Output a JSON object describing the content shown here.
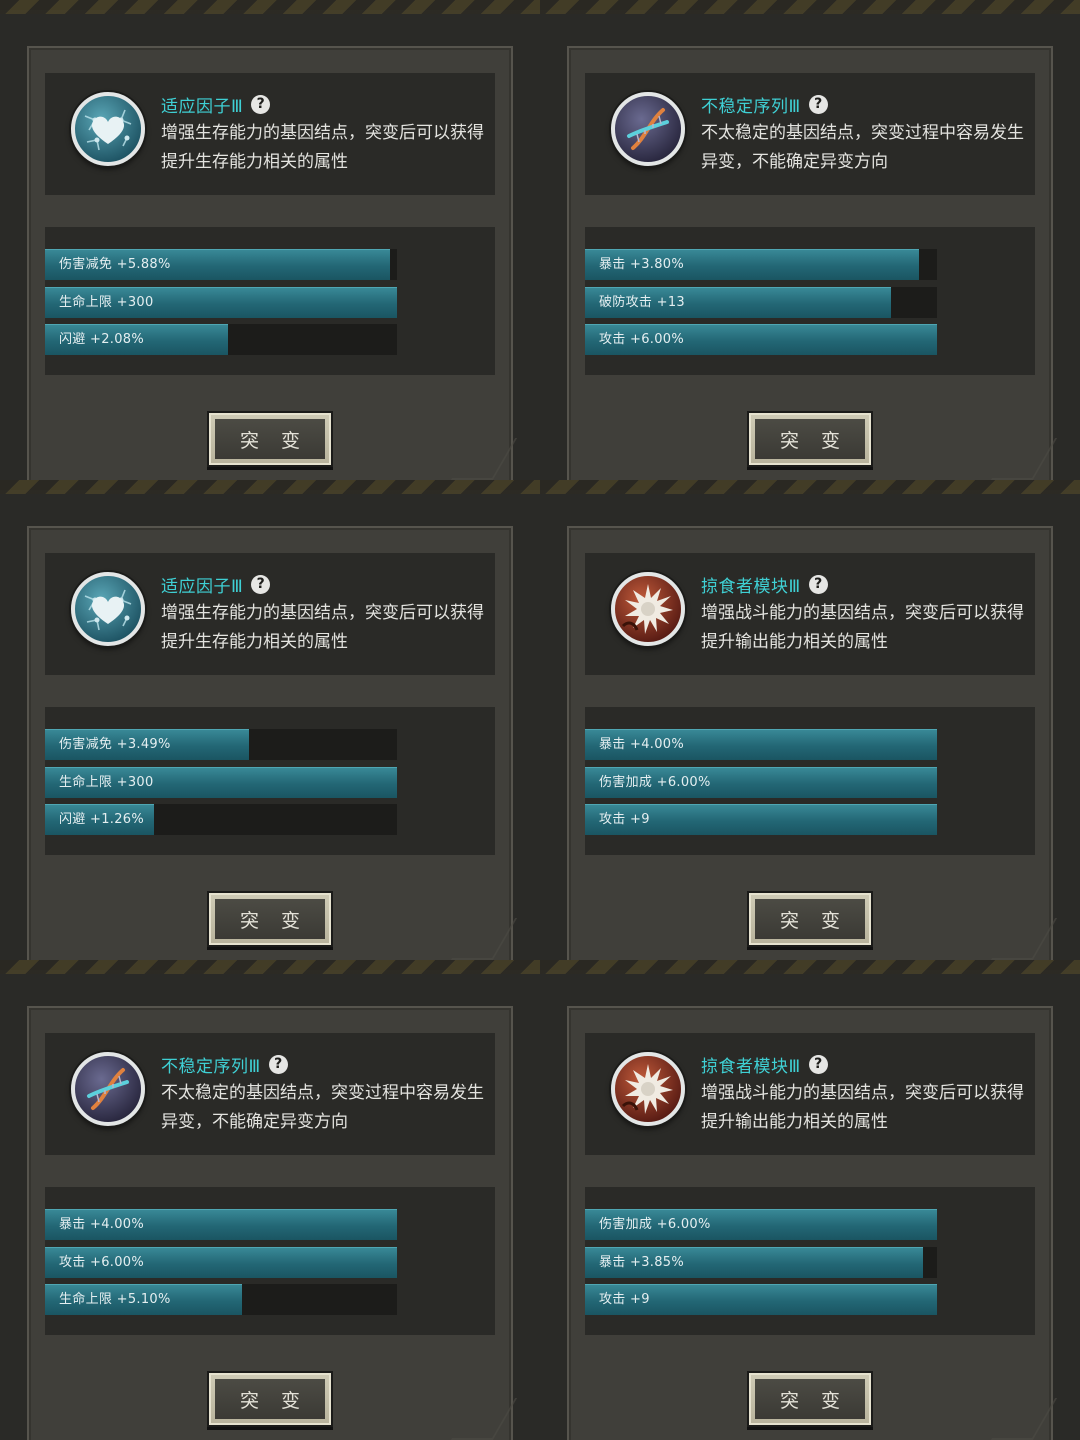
{
  "help_glyph": "?",
  "button_label": "突 变",
  "cards": [
    {
      "icon": "heart-icon",
      "title": "适应因子Ⅲ",
      "description": "增强生存能力的基因结点，突变后可以获得提升生存能力相关的属性",
      "stats": [
        {
          "label": "伤害减免 +5.88%",
          "fill": 0.98
        },
        {
          "label": "生命上限 +300",
          "fill": 1.0
        },
        {
          "label": "闪避 +2.08%",
          "fill": 0.52
        }
      ]
    },
    {
      "icon": "dna-icon",
      "title": "不稳定序列Ⅲ",
      "description": "不太稳定的基因结点，突变过程中容易发生异变，不能确定异变方向",
      "stats": [
        {
          "label": "暴击 +3.80%",
          "fill": 0.95
        },
        {
          "label": "破防攻击 +13",
          "fill": 0.87
        },
        {
          "label": "攻击 +6.00%",
          "fill": 1.0
        }
      ]
    },
    {
      "icon": "heart-icon",
      "title": "适应因子Ⅲ",
      "description": "增强生存能力的基因结点，突变后可以获得提升生存能力相关的属性",
      "stats": [
        {
          "label": "伤害减免 +3.49%",
          "fill": 0.58
        },
        {
          "label": "生命上限 +300",
          "fill": 1.0
        },
        {
          "label": "闪避 +1.26%",
          "fill": 0.31
        }
      ]
    },
    {
      "icon": "predator-icon",
      "title": "掠食者模块Ⅲ",
      "description": "增强战斗能力的基因结点，突变后可以获得提升输出能力相关的属性",
      "stats": [
        {
          "label": "暴击 +4.00%",
          "fill": 1.0
        },
        {
          "label": "伤害加成 +6.00%",
          "fill": 1.0
        },
        {
          "label": "攻击 +9",
          "fill": 1.0
        }
      ]
    },
    {
      "icon": "dna-icon",
      "title": "不稳定序列Ⅲ",
      "description": "不太稳定的基因结点，突变过程中容易发生异变，不能确定异变方向",
      "stats": [
        {
          "label": "暴击 +4.00%",
          "fill": 1.0
        },
        {
          "label": "攻击 +6.00%",
          "fill": 1.0
        },
        {
          "label": "生命上限 +5.10%",
          "fill": 0.56
        }
      ]
    },
    {
      "icon": "predator-icon",
      "title": "掠食者模块Ⅲ",
      "description": "增强战斗能力的基因结点，突变后可以获得提升输出能力相关的属性",
      "stats": [
        {
          "label": "伤害加成 +6.00%",
          "fill": 1.0
        },
        {
          "label": "暴击 +3.85%",
          "fill": 0.96
        },
        {
          "label": "攻击 +9",
          "fill": 1.0
        }
      ]
    }
  ]
}
